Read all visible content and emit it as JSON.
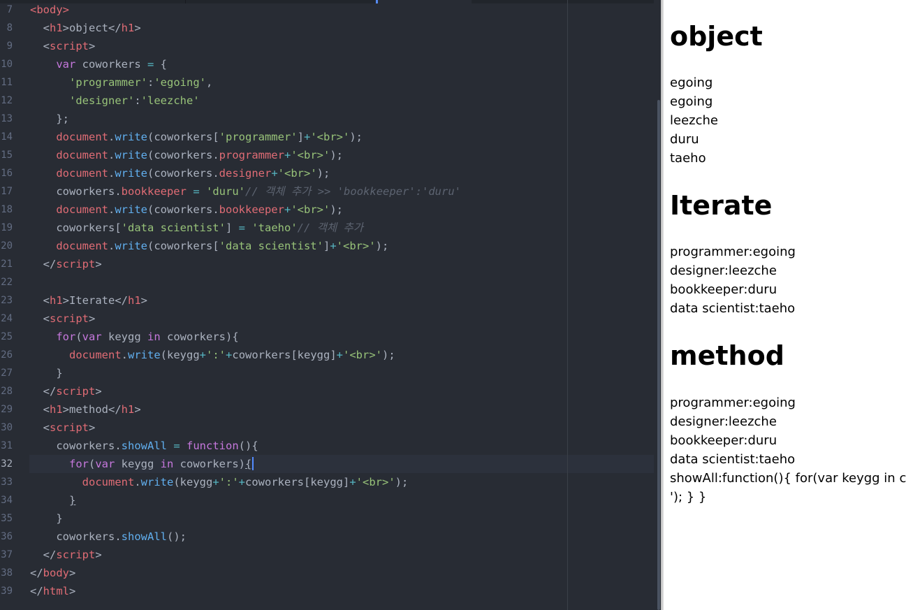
{
  "editor": {
    "lines": [
      {
        "n": "7",
        "t": [
          [
            "tag",
            "<body>"
          ]
        ]
      },
      {
        "n": "8",
        "t": [
          [
            "pn",
            "  <"
          ],
          [
            "tag",
            "h1"
          ],
          [
            "pn",
            ">object</"
          ],
          [
            "tag",
            "h1"
          ],
          [
            "pn",
            ">"
          ]
        ]
      },
      {
        "n": "9",
        "t": [
          [
            "pn",
            "  <"
          ],
          [
            "tag",
            "script"
          ],
          [
            "pn",
            ">"
          ]
        ]
      },
      {
        "n": "10",
        "t": [
          [
            "pn",
            "    "
          ],
          [
            "kw",
            "var"
          ],
          [
            "pn",
            " coworkers "
          ],
          [
            "op",
            "="
          ],
          [
            "pn",
            " {"
          ]
        ]
      },
      {
        "n": "11",
        "t": [
          [
            "pn",
            "      "
          ],
          [
            "str",
            "'programmer'"
          ],
          [
            "pn",
            ":"
          ],
          [
            "str",
            "'egoing'"
          ],
          [
            "pn",
            ","
          ]
        ]
      },
      {
        "n": "12",
        "t": [
          [
            "pn",
            "      "
          ],
          [
            "str",
            "'designer'"
          ],
          [
            "pn",
            ":"
          ],
          [
            "str",
            "'leezche'"
          ]
        ]
      },
      {
        "n": "13",
        "t": [
          [
            "pn",
            "    };"
          ]
        ]
      },
      {
        "n": "14",
        "t": [
          [
            "pn",
            "    "
          ],
          [
            "prop",
            "document"
          ],
          [
            "pn",
            "."
          ],
          [
            "fn",
            "write"
          ],
          [
            "pn",
            "(coworkers["
          ],
          [
            "str",
            "'programmer'"
          ],
          [
            "pn",
            "]"
          ],
          [
            "op",
            "+"
          ],
          [
            "str",
            "'<br>'"
          ],
          [
            "pn",
            ");"
          ]
        ]
      },
      {
        "n": "15",
        "t": [
          [
            "pn",
            "    "
          ],
          [
            "prop",
            "document"
          ],
          [
            "pn",
            "."
          ],
          [
            "fn",
            "write"
          ],
          [
            "pn",
            "(coworkers."
          ],
          [
            "prop",
            "programmer"
          ],
          [
            "op",
            "+"
          ],
          [
            "str",
            "'<br>'"
          ],
          [
            "pn",
            ");"
          ]
        ]
      },
      {
        "n": "16",
        "t": [
          [
            "pn",
            "    "
          ],
          [
            "prop",
            "document"
          ],
          [
            "pn",
            "."
          ],
          [
            "fn",
            "write"
          ],
          [
            "pn",
            "(coworkers."
          ],
          [
            "prop",
            "designer"
          ],
          [
            "op",
            "+"
          ],
          [
            "str",
            "'<br>'"
          ],
          [
            "pn",
            ");"
          ]
        ]
      },
      {
        "n": "17",
        "t": [
          [
            "pn",
            "    coworkers."
          ],
          [
            "prop",
            "bookkeeper"
          ],
          [
            "pn",
            " "
          ],
          [
            "op",
            "="
          ],
          [
            "pn",
            " "
          ],
          [
            "str",
            "'duru'"
          ],
          [
            "cm",
            "// 객체 추가 >> 'bookkeeper':'duru'"
          ]
        ]
      },
      {
        "n": "18",
        "t": [
          [
            "pn",
            "    "
          ],
          [
            "prop",
            "document"
          ],
          [
            "pn",
            "."
          ],
          [
            "fn",
            "write"
          ],
          [
            "pn",
            "(coworkers."
          ],
          [
            "prop",
            "bookkeeper"
          ],
          [
            "op",
            "+"
          ],
          [
            "str",
            "'<br>'"
          ],
          [
            "pn",
            ");"
          ]
        ]
      },
      {
        "n": "19",
        "t": [
          [
            "pn",
            "    coworkers["
          ],
          [
            "str",
            "'data scientist'"
          ],
          [
            "pn",
            "] "
          ],
          [
            "op",
            "="
          ],
          [
            "pn",
            " "
          ],
          [
            "str",
            "'taeho'"
          ],
          [
            "cm",
            "// 객체 추가"
          ]
        ]
      },
      {
        "n": "20",
        "t": [
          [
            "pn",
            "    "
          ],
          [
            "prop",
            "document"
          ],
          [
            "pn",
            "."
          ],
          [
            "fn",
            "write"
          ],
          [
            "pn",
            "(coworkers["
          ],
          [
            "str",
            "'data scientist'"
          ],
          [
            "pn",
            "]"
          ],
          [
            "op",
            "+"
          ],
          [
            "str",
            "'<br>'"
          ],
          [
            "pn",
            ");"
          ]
        ]
      },
      {
        "n": "21",
        "t": [
          [
            "pn",
            "  </"
          ],
          [
            "tag",
            "script"
          ],
          [
            "pn",
            ">"
          ]
        ]
      },
      {
        "n": "22",
        "t": []
      },
      {
        "n": "23",
        "t": [
          [
            "pn",
            "  <"
          ],
          [
            "tag",
            "h1"
          ],
          [
            "pn",
            ">Iterate</"
          ],
          [
            "tag",
            "h1"
          ],
          [
            "pn",
            ">"
          ]
        ]
      },
      {
        "n": "24",
        "t": [
          [
            "pn",
            "  <"
          ],
          [
            "tag",
            "script"
          ],
          [
            "pn",
            ">"
          ]
        ]
      },
      {
        "n": "25",
        "t": [
          [
            "pn",
            "    "
          ],
          [
            "kw",
            "for"
          ],
          [
            "pn",
            "("
          ],
          [
            "kw",
            "var"
          ],
          [
            "pn",
            " keygg "
          ],
          [
            "kw",
            "in"
          ],
          [
            "pn",
            " coworkers){"
          ]
        ]
      },
      {
        "n": "26",
        "t": [
          [
            "pn",
            "      "
          ],
          [
            "prop",
            "document"
          ],
          [
            "pn",
            "."
          ],
          [
            "fn",
            "write"
          ],
          [
            "pn",
            "(keygg"
          ],
          [
            "op",
            "+"
          ],
          [
            "str",
            "':'"
          ],
          [
            "op",
            "+"
          ],
          [
            "pn",
            "coworkers[keygg]"
          ],
          [
            "op",
            "+"
          ],
          [
            "str",
            "'<br>'"
          ],
          [
            "pn",
            ");"
          ]
        ]
      },
      {
        "n": "27",
        "t": [
          [
            "pn",
            "    }"
          ]
        ]
      },
      {
        "n": "28",
        "t": [
          [
            "pn",
            "  </"
          ],
          [
            "tag",
            "script"
          ],
          [
            "pn",
            ">"
          ]
        ]
      },
      {
        "n": "29",
        "t": [
          [
            "pn",
            "  <"
          ],
          [
            "tag",
            "h1"
          ],
          [
            "pn",
            ">method</"
          ],
          [
            "tag",
            "h1"
          ],
          [
            "pn",
            ">"
          ]
        ]
      },
      {
        "n": "30",
        "t": [
          [
            "pn",
            "  <"
          ],
          [
            "tag",
            "script"
          ],
          [
            "pn",
            ">"
          ]
        ]
      },
      {
        "n": "31",
        "t": [
          [
            "pn",
            "    coworkers."
          ],
          [
            "fn",
            "showAll"
          ],
          [
            "pn",
            " "
          ],
          [
            "op",
            "="
          ],
          [
            "pn",
            " "
          ],
          [
            "kw",
            "function"
          ],
          [
            "pn",
            "(){"
          ]
        ]
      },
      {
        "n": "32",
        "current": true,
        "t": [
          [
            "pn",
            "      "
          ],
          [
            "kw",
            "for"
          ],
          [
            "pn",
            "("
          ],
          [
            "kw",
            "var"
          ],
          [
            "pn",
            " keygg "
          ],
          [
            "kw",
            "in"
          ],
          [
            "pn",
            " coworkers)"
          ],
          [
            "ul",
            "{"
          ],
          [
            "caret",
            ""
          ]
        ]
      },
      {
        "n": "33",
        "t": [
          [
            "pn",
            "        "
          ],
          [
            "prop",
            "document"
          ],
          [
            "pn",
            "."
          ],
          [
            "fn",
            "write"
          ],
          [
            "pn",
            "(keygg"
          ],
          [
            "op",
            "+"
          ],
          [
            "str",
            "':'"
          ],
          [
            "op",
            "+"
          ],
          [
            "pn",
            "coworkers[keygg]"
          ],
          [
            "op",
            "+"
          ],
          [
            "str",
            "'<br>'"
          ],
          [
            "pn",
            ");"
          ]
        ]
      },
      {
        "n": "34",
        "t": [
          [
            "pn",
            "      "
          ],
          [
            "ul",
            "}"
          ]
        ]
      },
      {
        "n": "35",
        "t": [
          [
            "pn",
            "    }"
          ]
        ]
      },
      {
        "n": "36",
        "t": [
          [
            "pn",
            "    coworkers."
          ],
          [
            "fn",
            "showAll"
          ],
          [
            "pn",
            "();"
          ]
        ]
      },
      {
        "n": "37",
        "t": [
          [
            "pn",
            "  </"
          ],
          [
            "tag",
            "script"
          ],
          [
            "pn",
            ">"
          ]
        ]
      },
      {
        "n": "38",
        "t": [
          [
            "pn",
            "</"
          ],
          [
            "tag",
            "body"
          ],
          [
            "pn",
            ">"
          ]
        ]
      },
      {
        "n": "39",
        "t": [
          [
            "pn",
            "</"
          ],
          [
            "tag",
            "html"
          ],
          [
            "pn",
            ">"
          ]
        ]
      }
    ]
  },
  "preview": {
    "h1_object": "object",
    "object_lines": [
      "egoing",
      "egoing",
      "leezche",
      "duru",
      "taeho"
    ],
    "h1_iterate": "Iterate",
    "iterate_lines": [
      "programmer:egoing",
      "designer:leezche",
      "bookkeeper:duru",
      "data scientist:taeho"
    ],
    "h1_method": "method",
    "method_lines": [
      "programmer:egoing",
      "designer:leezche",
      "bookkeeper:duru",
      "data scientist:taeho",
      "showAll:function(){ for(var keygg in co",
      "'); } }"
    ]
  }
}
